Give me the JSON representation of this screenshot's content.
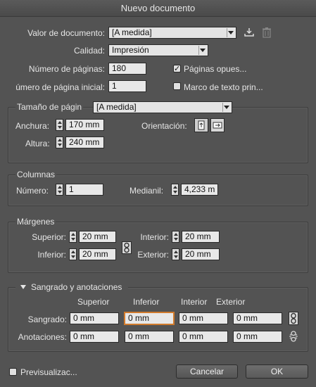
{
  "window": {
    "title": "Nuevo documento"
  },
  "preset": {
    "label": "Valor de documento:",
    "value": "[A medida]"
  },
  "quality": {
    "label": "Calidad:",
    "value": "Impresión"
  },
  "pages": {
    "count_label": "Número de páginas:",
    "count_value": "180",
    "start_label": "úmero de página inicial:",
    "start_value": "1",
    "facing_label": "Páginas opues...",
    "facing_checked": true,
    "master_text_label": "Marco de texto prin...",
    "master_text_checked": false
  },
  "page_size": {
    "label": "Tamaño de págin",
    "value": "[A medida]",
    "width_label": "Anchura:",
    "width_value": "170 mm",
    "height_label": "Altura:",
    "height_value": "240 mm",
    "orientation_label": "Orientación:"
  },
  "columns": {
    "title": "Columnas",
    "number_label": "Número:",
    "number_value": "1",
    "gutter_label": "Medianil:",
    "gutter_value": "4,233 m"
  },
  "margins": {
    "title": "Márgenes",
    "top_label": "Superior:",
    "top_value": "20 mm",
    "bottom_label": "Inferior:",
    "bottom_value": "20 mm",
    "inside_label": "Interior:",
    "inside_value": "20 mm",
    "outside_label": "Exterior:",
    "outside_value": "20 mm"
  },
  "bleed": {
    "title": "Sangrado y anotaciones",
    "col_top": "Superior",
    "col_bottom": "Inferior",
    "col_inside": "Interior",
    "col_outside": "Exterior",
    "bleed_label": "Sangrado:",
    "bleed_values": [
      "0 mm",
      "0 mm",
      "0 mm",
      "0 mm"
    ],
    "slug_label": "Anotaciones:",
    "slug_values": [
      "0 mm",
      "0 mm",
      "0 mm",
      "0 mm"
    ]
  },
  "footer": {
    "preview_label": "Previsualizac...",
    "preview_checked": false,
    "cancel_label": "Cancelar",
    "ok_label": "OK"
  }
}
